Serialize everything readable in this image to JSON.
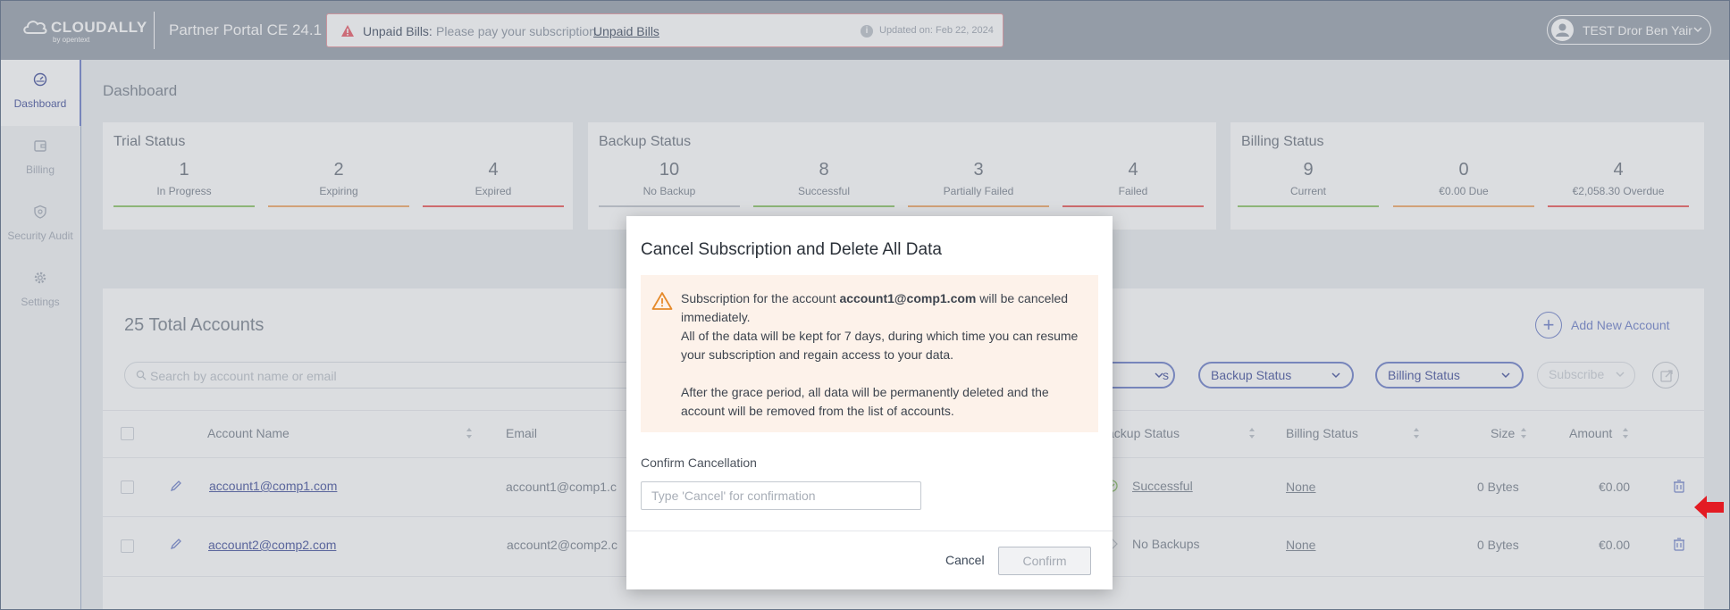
{
  "header": {
    "logo_text": "CLOUDALLY",
    "logo_sub": "by opentext",
    "portal_title": "Partner Portal CE 24.1",
    "alert": {
      "title": "Unpaid Bills:",
      "message": "Please pay your subscription.",
      "link": "Unpaid Bills",
      "updated": "Updated on: Feb 22, 2024"
    },
    "user_name": "TEST Dror Ben Yair"
  },
  "sidebar": {
    "items": [
      {
        "label": "Dashboard",
        "icon": "dashboard-icon",
        "active": true
      },
      {
        "label": "Billing",
        "icon": "wallet-icon"
      },
      {
        "label": "Security Audit",
        "icon": "shield-icon"
      },
      {
        "label": "Settings",
        "icon": "gear-icon"
      }
    ]
  },
  "page_title": "Dashboard",
  "cards": {
    "trial": {
      "title": "Trial Status",
      "stats": [
        {
          "value": "1",
          "label": "In Progress",
          "color": "#9ccc7a"
        },
        {
          "value": "2",
          "label": "Expiring",
          "color": "#f4b27a"
        },
        {
          "value": "4",
          "label": "Expired",
          "color": "#ef6d6d"
        }
      ]
    },
    "backup": {
      "title": "Backup Status",
      "stats": [
        {
          "value": "10",
          "label": "No Backup",
          "color": "#c9cdd4"
        },
        {
          "value": "8",
          "label": "Successful",
          "color": "#9ccc7a"
        },
        {
          "value": "3",
          "label": "Partially Failed",
          "color": "#f4b27a"
        },
        {
          "value": "4",
          "label": "Failed",
          "color": "#ef6d6d"
        }
      ]
    },
    "billing": {
      "title": "Billing Status",
      "stats": [
        {
          "value": "9",
          "label": "Current",
          "color": "#9ccc7a"
        },
        {
          "value": "0",
          "label": "€0.00 Due",
          "color": "#f4b27a"
        },
        {
          "value": "4",
          "label": "€2,058.30 Overdue",
          "color": "#ef6d6d"
        }
      ]
    }
  },
  "accounts": {
    "title": "25 Total Accounts",
    "add_label": "Add New Account",
    "search_placeholder": "Search by account name or email",
    "filters": {
      "partial": "s",
      "backup": "Backup Status",
      "billing": "Billing Status",
      "subscribe": "Subscribe"
    },
    "columns": {
      "name": "Account Name",
      "email": "Email",
      "backup": "ackup Status",
      "billing": "Billing Status",
      "size": "Size",
      "amount": "Amount"
    },
    "rows": [
      {
        "name": "account1@comp1.com",
        "email": "account1@comp1.c",
        "backup": "Successful",
        "billing": "None",
        "size": "0 Bytes",
        "amount": "€0.00"
      },
      {
        "name": "account2@comp2.com",
        "email": "account2@comp2.c",
        "backup": "No Backups",
        "billing": "None",
        "size": "0 Bytes",
        "amount": "€0.00"
      }
    ]
  },
  "modal": {
    "title": "Cancel Subscription and Delete All Data",
    "warning": {
      "prefix": "Subscription for the account ",
      "account": "account1@comp1.com",
      "suffix": " will be canceled immediately.",
      "line2": "All of the data will be kept for 7 days, during which time you can resume your subscription and regain access to your data.",
      "line3": "After the grace period, all data will be permanently deleted and the account will be removed from the list of accounts."
    },
    "confirm_label": "Confirm Cancellation",
    "confirm_placeholder": "Type 'Cancel' for confirmation",
    "cancel": "Cancel",
    "confirm": "Confirm"
  }
}
